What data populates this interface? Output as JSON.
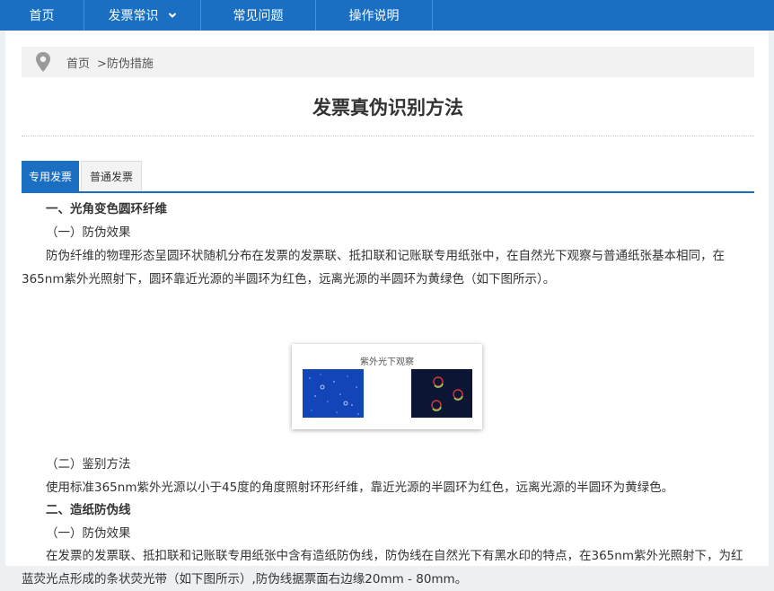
{
  "nav": {
    "items": [
      {
        "label": "首页"
      },
      {
        "label": "发票常识"
      },
      {
        "label": "常见问题"
      },
      {
        "label": "操作说明"
      }
    ]
  },
  "breadcrumb": {
    "icon": "location-pin-icon",
    "home": "首页",
    "current": ">防伪措施"
  },
  "article": {
    "title": "发票真伪识别方法",
    "tabs": [
      {
        "label": "专用发票",
        "active": true
      },
      {
        "label": "普通发票",
        "active": false
      }
    ],
    "p1": "一、光角变色圆环纤维",
    "p2": "（一）防伪效果",
    "p3": "防伪纤维的物理形态呈圆环状随机分布在发票的发票联、抵扣联和记账联专用纸张中，在自然光下观察与普通纸张基本相同，在365nm紫外光照射下，圆环靠近光源的半圆环为红色，远离光源的半圆环为黄绿色（如下图所示）。",
    "figure_caption": "紫外光下观察",
    "p4": "（二）鉴别方法",
    "p5": "使用标准365nm紫外光源以小于45度的角度照射环形纤维，靠近光源的半圆环为红色，远离光源的半圆环为黄绿色。",
    "p6": "二、造纸防伪线",
    "p7": "（一）防伪效果",
    "p8": "在发票的发票联、抵扣联和记账联专用纸张中含有造纸防伪线，防伪线在自然光下有黑水印的特点，在365nm紫外光照射下，为红蓝荧光点形成的条状荧光带（如下图所示）,防伪线据票面右边缘20mm - 80mm。"
  },
  "colors": {
    "nav_bg": "#1a6fc2",
    "tab_active": "#1a6fc2"
  }
}
